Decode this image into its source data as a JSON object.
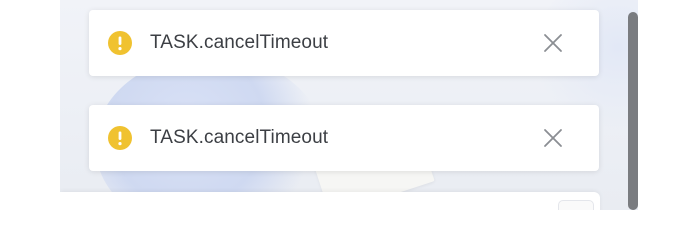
{
  "notifications": [
    {
      "message": "TASK.cancelTimeout",
      "type": "warning",
      "icon": "warning-circle-icon",
      "close_icon": "close-icon"
    },
    {
      "message": "TASK.cancelTimeout",
      "type": "warning",
      "icon": "warning-circle-icon",
      "close_icon": "close-icon"
    }
  ],
  "colors": {
    "warning": "#F0C230",
    "message_text": "#3C3F44",
    "close_icon": "#8B8E93",
    "scrollbar": "#7A7C80"
  }
}
